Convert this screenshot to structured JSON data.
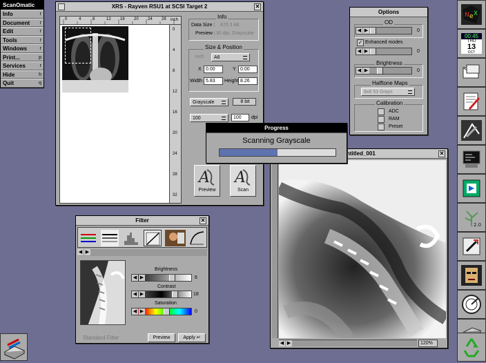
{
  "main_menu": {
    "title": "ScanOmatic",
    "items": [
      {
        "label": "Info",
        "key": "r"
      },
      {
        "label": "Document",
        "key": "r"
      },
      {
        "label": "Edit",
        "key": "r"
      },
      {
        "label": "Tools",
        "key": "r"
      },
      {
        "label": "Windows",
        "key": "r"
      },
      {
        "label": "Print...",
        "key": "p"
      },
      {
        "label": "Services",
        "key": "r"
      },
      {
        "label": "Hide",
        "key": "h"
      },
      {
        "label": "Quit",
        "key": "q"
      }
    ]
  },
  "scan_window": {
    "title": "XRS - Rayven RSU1 at SCSI Target 2",
    "ruler_unit": "inch",
    "ruler_ticks": [
      "0",
      "4",
      "8",
      "12",
      "16",
      "20",
      "24",
      "28"
    ],
    "side_ticks": [
      "0",
      "4",
      "8",
      "12",
      "16",
      "20",
      "24",
      "28",
      "32"
    ],
    "info": {
      "title": "Info",
      "data_size_label": "Data Size :",
      "data_size_value": "470.3 kB",
      "preview_label": "Preview :",
      "preview_value": "30 dpi, Grayscale"
    },
    "size_position": {
      "title": "Size & Position",
      "unit": "inch",
      "paper": "A6",
      "x_label": "X",
      "x_value": "0.00",
      "y_label": "Y",
      "y_value": "0.00",
      "width_label": "Width",
      "width_value": "5.83",
      "height_label": "Height",
      "height_value": "8.26"
    },
    "mode": "Grayscale",
    "bits": "8 bit",
    "scale": "100",
    "dpi_value": "100",
    "dpi_label": "dpi",
    "preview_button": "Preview",
    "scan_button": "Scan"
  },
  "options_window": {
    "title": "Options",
    "od_title": "OD",
    "od_value": "0",
    "enhanced_modes": "Enhanced modes",
    "enhanced_value": "0",
    "brightness_title": "Brightness",
    "brightness_value": "0",
    "halftone_title": "Halftone Maps",
    "halftone_value": "8x8 53 Grays",
    "calibration_title": "Calibration",
    "calibration_items": [
      "ADC",
      "RAM",
      "Preset"
    ]
  },
  "progress_window": {
    "title": "Progress",
    "message": "Scanning Grayscale",
    "progress": 0.5
  },
  "image_window": {
    "title": "Untitled_001",
    "zoom": "120%"
  },
  "filter_window": {
    "title": "Filter",
    "brightness_label": "Brightness",
    "brightness_value": "6",
    "contrast_label": "Contrast",
    "contrast_value": "18",
    "saturation_label": "Saturation",
    "saturation_value": "0",
    "filter_name": "Standard Filter",
    "preview_button": "Preview",
    "apply_button": "Apply"
  },
  "dock": {
    "clock": "00:45",
    "cal_day": "THU",
    "cal_date": "13",
    "cal_month": "OCT",
    "version_label": "2.0"
  }
}
